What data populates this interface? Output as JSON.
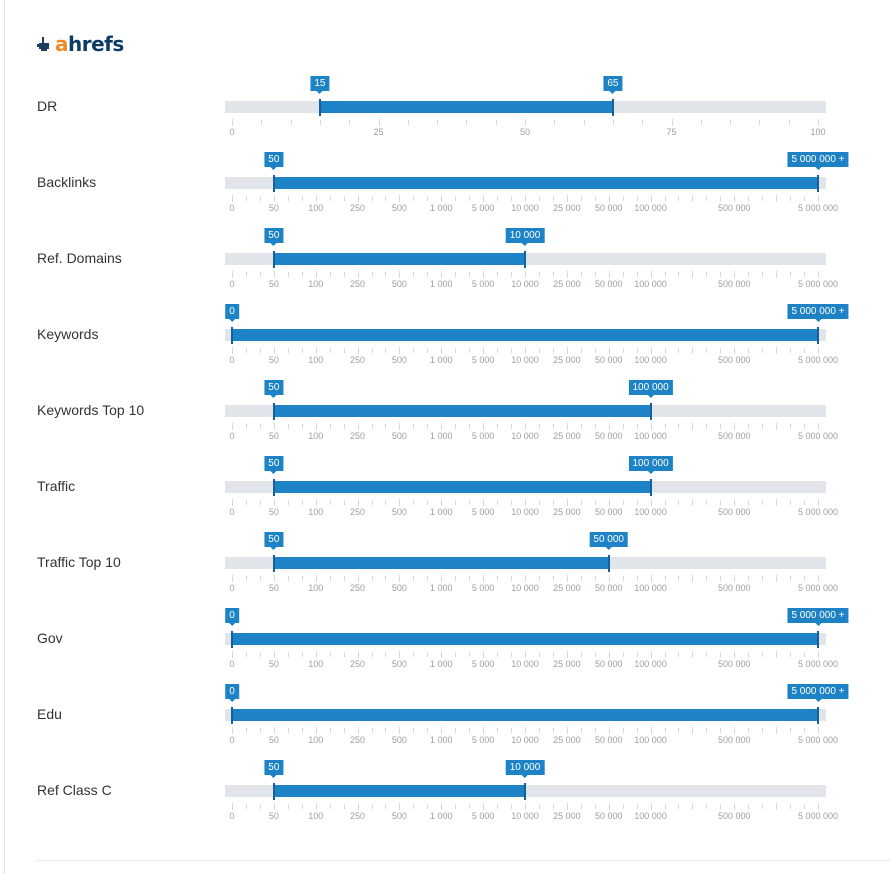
{
  "brand": {
    "logo_a": "a",
    "logo_rest": "hrefs",
    "icon": "ahrefs-hand-icon",
    "accent": "#1e83c6",
    "orange": "#f08a24"
  },
  "scales": {
    "dr": {
      "labels": [
        "0",
        "25",
        "50",
        "75",
        "100"
      ],
      "values": [
        0,
        25,
        50,
        75,
        100
      ]
    },
    "log": {
      "slots": [
        "0",
        "50",
        "100",
        "250",
        "500",
        "1 000",
        "5 000",
        "10 000",
        "25 000",
        "50 000",
        "100 000",
        "",
        "500 000",
        "",
        "5 000 000"
      ],
      "values": [
        0,
        50,
        100,
        250,
        500,
        1000,
        5000,
        10000,
        25000,
        50000,
        100000,
        null,
        500000,
        null,
        5000000
      ]
    }
  },
  "filters": [
    {
      "label": "DR",
      "scale": "dr",
      "min": 15,
      "max": 65,
      "min_label": "15",
      "max_label": "65"
    },
    {
      "label": "Backlinks",
      "scale": "log",
      "min": 50,
      "max": 5000000,
      "min_label": "50",
      "max_label": "5 000 000 +"
    },
    {
      "label": "Ref. Domains",
      "scale": "log",
      "min": 50,
      "max": 10000,
      "min_label": "50",
      "max_label": "10 000"
    },
    {
      "label": "Keywords",
      "scale": "log",
      "min": 0,
      "max": 5000000,
      "min_label": "0",
      "max_label": "5 000 000 +"
    },
    {
      "label": "Keywords Top 10",
      "scale": "log",
      "min": 50,
      "max": 100000,
      "min_label": "50",
      "max_label": "100 000"
    },
    {
      "label": "Traffic",
      "scale": "log",
      "min": 50,
      "max": 100000,
      "min_label": "50",
      "max_label": "100 000"
    },
    {
      "label": "Traffic Top 10",
      "scale": "log",
      "min": 50,
      "max": 50000,
      "min_label": "50",
      "max_label": "50 000"
    },
    {
      "label": "Gov",
      "scale": "log",
      "min": 0,
      "max": 5000000,
      "min_label": "0",
      "max_label": "5 000 000 +"
    },
    {
      "label": "Edu",
      "scale": "log",
      "min": 0,
      "max": 5000000,
      "min_label": "0",
      "max_label": "5 000 000 +"
    },
    {
      "label": "Ref Class C",
      "scale": "log",
      "min": 50,
      "max": 10000,
      "min_label": "50",
      "max_label": "10 000"
    }
  ]
}
